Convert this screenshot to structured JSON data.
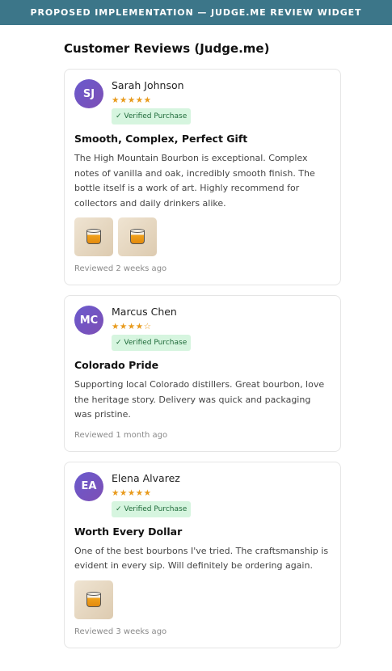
{
  "banner": {
    "text": "Proposed Implementation — Judge.me Review Widget"
  },
  "widget": {
    "title": "Customer Reviews (Judge.me)"
  },
  "colors": {
    "banner": "#3c7689",
    "star": "#e89a1c",
    "badge_bg": "#d6f5df",
    "badge_text": "#1f6b3a",
    "avatar": "#6a5acd"
  },
  "reviews": [
    {
      "initials": "SJ",
      "name": "Sarah Johnson",
      "stars": "★★★★★",
      "rating": 5,
      "badge": "✓ Verified Purchase",
      "title": "Smooth, Complex, Perfect Gift",
      "body": "The High Mountain Bourbon is exceptional. Complex notes of vanilla and oak, incredibly smooth finish. The bottle itself is a work of art. Highly recommend for collectors and daily drinkers alike.",
      "photos": [
        "whiskey-glass-icon",
        "whiskey-glass-icon"
      ],
      "date": "Reviewed 2 weeks ago"
    },
    {
      "initials": "MC",
      "name": "Marcus Chen",
      "stars": "★★★★☆",
      "rating": 4,
      "badge": "✓ Verified Purchase",
      "title": "Colorado Pride",
      "body": "Supporting local Colorado distillers. Great bourbon, love the heritage story. Delivery was quick and packaging was pristine.",
      "photos": [],
      "date": "Reviewed 1 month ago"
    },
    {
      "initials": "EA",
      "name": "Elena Alvarez",
      "stars": "★★★★★",
      "rating": 5,
      "badge": "✓ Verified Purchase",
      "title": "Worth Every Dollar",
      "body": "One of the best bourbons I've tried. The craftsmanship is evident in every sip. Will definitely be ordering again.",
      "photos": [
        "whiskey-glass-icon"
      ],
      "date": "Reviewed 3 weeks ago"
    }
  ]
}
